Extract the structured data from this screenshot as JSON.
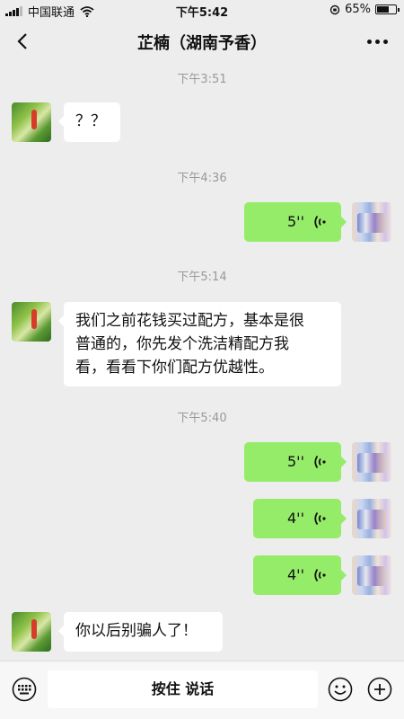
{
  "status_bar": {
    "carrier": "中国联通",
    "time": "下午5:42",
    "battery": "65%",
    "battery_level": 0.65
  },
  "nav": {
    "title": "芷楠（湖南予香）"
  },
  "messages": [
    {
      "type": "timestamp",
      "text": "下午3:51"
    },
    {
      "type": "text",
      "side": "left",
      "text": "？？"
    },
    {
      "type": "timestamp",
      "text": "下午4:36"
    },
    {
      "type": "voice",
      "side": "right",
      "duration": "5''"
    },
    {
      "type": "timestamp",
      "text": "下午5:14"
    },
    {
      "type": "text",
      "side": "left",
      "lines": [
        "我们之前花钱买过配方，基本是很",
        "普通的，你先发个洗洁精配方我",
        "看，看看下你们配方优越性。"
      ]
    },
    {
      "type": "timestamp",
      "text": "下午5:40"
    },
    {
      "type": "voice",
      "side": "right",
      "duration": "5''"
    },
    {
      "type": "voice",
      "side": "right",
      "duration": "4''"
    },
    {
      "type": "voice",
      "side": "right",
      "duration": "4''"
    },
    {
      "type": "text",
      "side": "left",
      "text": "你以后别骗人了！"
    }
  ],
  "input_bar": {
    "hold_to_talk": "按住 说话"
  }
}
